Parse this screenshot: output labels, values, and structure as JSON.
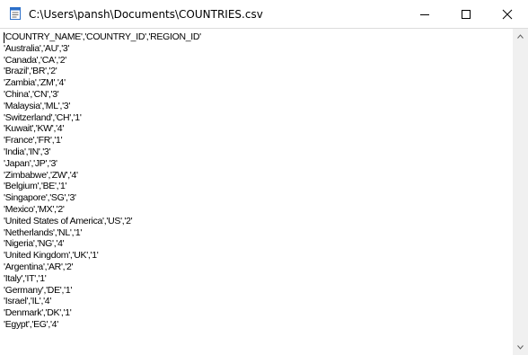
{
  "window": {
    "title": "C:\\Users\\pansh\\Documents\\COUNTRIES.csv"
  },
  "editor": {
    "lines": [
      "'COUNTRY_NAME','COUNTRY_ID','REGION_ID'",
      "'Australia','AU','3'",
      "'Canada','CA','2'",
      "'Brazil','BR','2'",
      "'Zambia','ZM','4'",
      "'China','CN','3'",
      "'Malaysia','ML','3'",
      "'Switzerland','CH','1'",
      "'Kuwait','KW','4'",
      "'France','FR','1'",
      "'India','IN','3'",
      "'Japan','JP','3'",
      "'Zimbabwe','ZW','4'",
      "'Belgium','BE','1'",
      "'Singapore','SG','3'",
      "'Mexico','MX','2'",
      "'United States of America','US','2'",
      "'Netherlands','NL','1'",
      "'Nigeria','NG','4'",
      "'United Kingdom','UK','1'",
      "'Argentina','AR','2'",
      "'Italy','IT','1'",
      "'Germany','DE','1'",
      "'Israel','IL','4'",
      "'Denmark','DK','1'",
      "'Egypt','EG','4'"
    ]
  },
  "icons": {
    "app": "notepad-icon",
    "minimize": "minimize-icon",
    "maximize": "maximize-icon",
    "close": "close-icon",
    "scroll_up": "chevron-up-icon",
    "scroll_down": "chevron-down-icon"
  },
  "colors": {
    "background": "#ffffff",
    "scrollbar": "#f0f0f0",
    "text": "#000000",
    "icon_blue": "#2b6fc9"
  }
}
